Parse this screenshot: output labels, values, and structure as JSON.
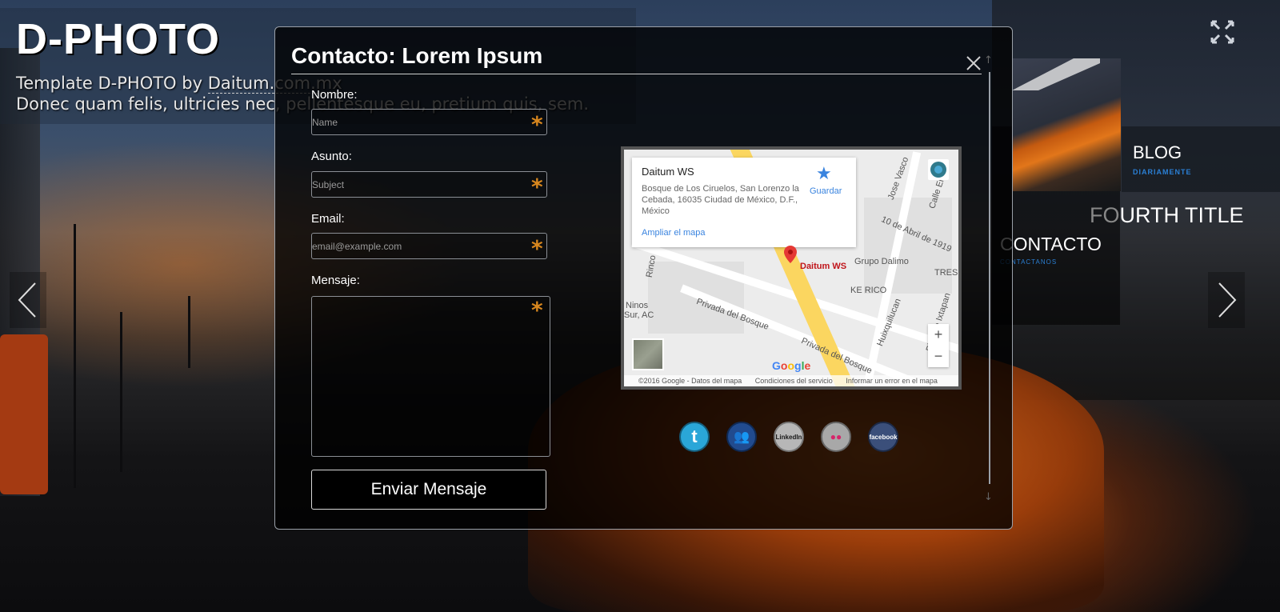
{
  "site": {
    "title": "D-PHOTO",
    "tagline_prefix": "Template D-PHOTO by ",
    "tagline_link": "Daitum.com.mx",
    "description": "Donec quam felis, ultricies nec, pellentesque eu, pretium quis, sem."
  },
  "right_menu": {
    "blog_title": "BLOG",
    "blog_sub": "DIARIAMENTE",
    "fourth_title_dim": "FO",
    "fourth_title_rest": "URTH TITLE",
    "contacto_title": "CONTACTO",
    "contacto_sub": "CONTACTANOS"
  },
  "modal": {
    "title": "Contacto: Lorem Ipsum",
    "close": "×"
  },
  "form": {
    "name_label": "Nombre:",
    "name_placeholder": "Name",
    "subject_label": "Asunto:",
    "subject_placeholder": "Subject",
    "email_label": "Email:",
    "email_placeholder": "email@example.com",
    "message_label": "Mensaje:",
    "required_mark": "*",
    "submit_label": "Enviar Mensaje"
  },
  "map": {
    "place_name": "Daitum WS",
    "address": "Bosque de Los Ciruelos, San Lorenzo la Cebada, 16035 Ciudad de México, D.F., México",
    "enlarge_link": "Ampliar el mapa",
    "save_label": "Guardar",
    "pin_label": "Daitum WS",
    "labels": [
      "Jose Vasco",
      "Calle Emilia",
      "10 de Abril de 1919",
      "Grupo Dalimo",
      "TRES",
      "KE RICO",
      "Ninos",
      "Sur, AC",
      "Privada del Bosque",
      "Privada del Bosque",
      "Huixquilucan",
      "Plan de Ixtapan",
      "Rinco"
    ],
    "zoom_in": "+",
    "zoom_out": "−",
    "logo": "Google",
    "footer": [
      "©2016 Google - Datos del mapa",
      "Condiciones del servicio",
      "Informar un error en el mapa"
    ]
  },
  "social": [
    {
      "name": "twitter",
      "label": "t",
      "color": "#2aa6d8"
    },
    {
      "name": "myspace",
      "label": "👥",
      "color": "#214b8f"
    },
    {
      "name": "linkedin",
      "label": "LinkedIn",
      "color": "#b7b7b7"
    },
    {
      "name": "flickr",
      "label": "●●",
      "color": "#a8a8a8"
    },
    {
      "name": "facebook",
      "label": "facebook",
      "color": "#3b4f7a"
    }
  ]
}
